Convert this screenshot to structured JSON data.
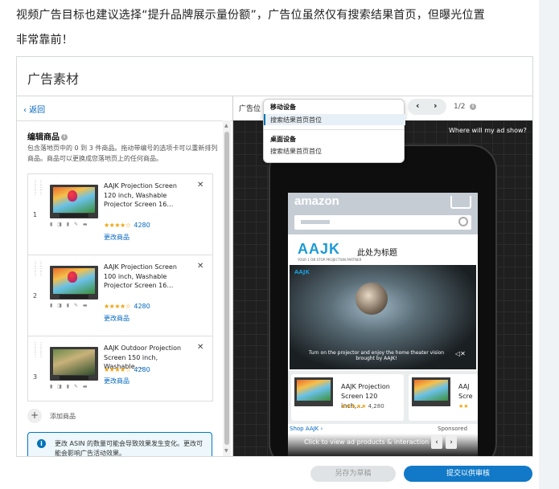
{
  "intro": {
    "line1": "视频广告目标也建议选择“提升品牌展示量份额”，广告位虽然仅有搜索结果首页，但曝光位置",
    "line2": "非常靠前！"
  },
  "panel": {
    "title": "广告素材",
    "back_label": "返回",
    "edit_title": "编辑商品",
    "edit_desc": "包含落地页中的 0 到 3 件商品。拖动带编号的选项卡可以重新排列商品。商品可以更换成您落地页上的任何商品。",
    "products": [
      {
        "num": "1",
        "name": "AAJK Projection Screen 120 inch, Washable Projector Screen 16…",
        "stars": "★★★★☆",
        "reviews": "4280",
        "change": "更改商品",
        "features": "▮ ◨ ▮ ✎ ▬"
      },
      {
        "num": "2",
        "name": "AAJK Projection Screen 100 inch, Washable Projector Screen 16…",
        "stars": "★★★★☆",
        "reviews": "4280",
        "change": "更改商品",
        "features": "▮ ◨ ▮ ✎ ▬"
      },
      {
        "num": "3",
        "name": "AAJK Outdoor Projection Screen 150 inch, Washable …",
        "stars": "★★★★☆",
        "reviews": "4280",
        "change": "更改商品",
        "features": "▮ ◨ ▮ ✎ ▬"
      }
    ],
    "add_label": "添加商品",
    "notice": "更改 ASIN 的数量可能会导致效果发生变化。更改可能会影响广告活动效果。"
  },
  "preview": {
    "placement_label": "广告位",
    "dropdown": {
      "group1": "移动设备",
      "item1": "搜索结果首页首位",
      "group2": "桌面设备",
      "item2": "搜索结果首页首位"
    },
    "page_num": "1/2",
    "where": "Where will my ad show?",
    "amazon": "amazon",
    "brand": "AAJK",
    "brand_sub": "YOUR 1 ON STOP PROJECTION PARTNER",
    "headline": "此处为标题",
    "video_caption": "Turn on the projector and enjoy the home theater vision brought by AAJK!",
    "card1": {
      "name": "AAJK Projection Screen 120 inch,…",
      "stars": "★★★★★",
      "reviews": "4,280"
    },
    "card2": {
      "name": "AAJ Scre",
      "stars": "★★"
    },
    "shop": "Shop AAJK ›",
    "sponsored": "Sponsored",
    "cta": "Click to view ad products & interaction"
  },
  "buttons": {
    "draft": "另存为草稿",
    "submit": "提交以供审核"
  },
  "colors": {
    "primary": "#1179c7",
    "link": "#0066c0",
    "star": "#f0a30a"
  }
}
